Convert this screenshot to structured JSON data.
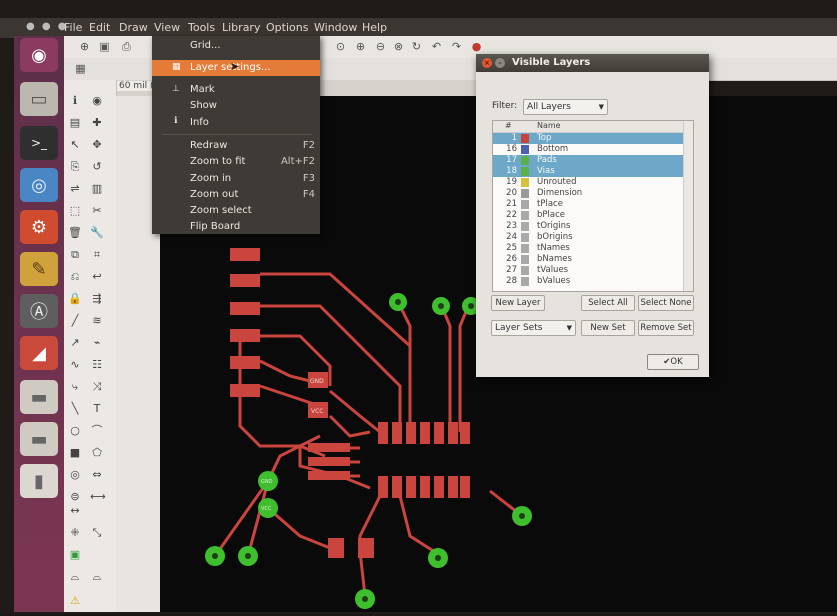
{
  "menubar": {
    "items": [
      "File",
      "Edit",
      "Draw",
      "View",
      "Tools",
      "Library",
      "Options",
      "Window",
      "Help"
    ]
  },
  "toolbar": {
    "grid_readout": "60 mil (",
    "icons": [
      "zoom-in-icon",
      "save-icon",
      "print-icon",
      "undo-icon",
      "redo-icon",
      "stop-icon",
      "zoom-icon"
    ]
  },
  "view_menu": {
    "items": [
      {
        "label": "Grid...",
        "shortcut": ""
      },
      {
        "label": "Layer settings...",
        "shortcut": "",
        "highlighted": true
      },
      {
        "label": "Mark",
        "shortcut": ""
      },
      {
        "label": "Show",
        "shortcut": ""
      },
      {
        "label": "Info",
        "shortcut": ""
      },
      {
        "label": "Redraw",
        "shortcut": "F2"
      },
      {
        "label": "Zoom to fit",
        "shortcut": "Alt+F2"
      },
      {
        "label": "Zoom in",
        "shortcut": "F3"
      },
      {
        "label": "Zoom out",
        "shortcut": "F4"
      },
      {
        "label": "Zoom select",
        "shortcut": ""
      },
      {
        "label": "Flip Board",
        "shortcut": ""
      }
    ]
  },
  "dialog": {
    "title": "Visible Layers",
    "filter_label": "Filter:",
    "filter_value": "All Layers",
    "columns": {
      "num": "#",
      "name": "Name"
    },
    "layers": [
      {
        "num": "1",
        "name": "Top",
        "color": "#c8433c",
        "selected": true
      },
      {
        "num": "16",
        "name": "Bottom",
        "color": "#4b5fb0",
        "selected": false
      },
      {
        "num": "17",
        "name": "Pads",
        "color": "#5ab04a",
        "selected": true
      },
      {
        "num": "18",
        "name": "Vias",
        "color": "#5ab04a",
        "selected": true
      },
      {
        "num": "19",
        "name": "Unrouted",
        "color": "#d6c13a",
        "selected": false
      },
      {
        "num": "20",
        "name": "Dimension",
        "color": "#9a9a9a",
        "selected": false
      },
      {
        "num": "21",
        "name": "tPlace",
        "color": "#a9a9a9",
        "selected": false
      },
      {
        "num": "22",
        "name": "bPlace",
        "color": "#a9a9a9",
        "selected": false
      },
      {
        "num": "23",
        "name": "tOrigins",
        "color": "#a9a9a9",
        "selected": false
      },
      {
        "num": "24",
        "name": "bOrigins",
        "color": "#a9a9a9",
        "selected": false
      },
      {
        "num": "25",
        "name": "tNames",
        "color": "#a9a9a9",
        "selected": false
      },
      {
        "num": "26",
        "name": "bNames",
        "color": "#a9a9a9",
        "selected": false
      },
      {
        "num": "27",
        "name": "tValues",
        "color": "#a9a9a9",
        "selected": false
      },
      {
        "num": "28",
        "name": "bValues",
        "color": "#a9a9a9",
        "selected": false
      }
    ],
    "buttons": {
      "new_layer": "New Layer",
      "select_all": "Select All",
      "select_none": "Select None",
      "layer_sets": "Layer Sets",
      "new_set": "New Set",
      "remove_set": "Remove Set",
      "ok": "OK"
    }
  },
  "board": {
    "labels": [
      "GND",
      "VCC",
      "GND",
      "VCC"
    ],
    "colors": {
      "trace": "#c9453d",
      "pad": "#3fbf2e",
      "background": "#0a0a0a"
    }
  }
}
